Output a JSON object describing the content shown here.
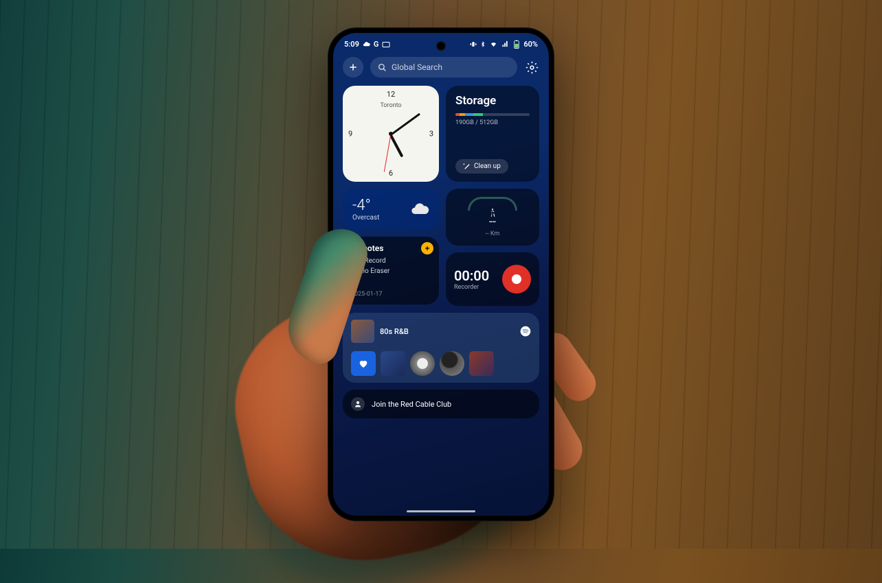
{
  "statusbar": {
    "time": "5:09",
    "indicators": "G",
    "battery": "60%"
  },
  "topbar": {
    "search_placeholder": "Global Search"
  },
  "clock": {
    "city": "Toronto",
    "n12": "12",
    "n3": "3",
    "n6": "6",
    "n9": "9"
  },
  "storage": {
    "title": "Storage",
    "usage": "190GB / 512GB",
    "cleanup_label": "Clean up"
  },
  "weather": {
    "temp": "-4°",
    "condition": "Overcast"
  },
  "notes": {
    "title": "All notes",
    "items": [
      "Call Record",
      "Audio Eraser",
      "…"
    ],
    "date": "2025-01-17"
  },
  "steps": {
    "value": "--",
    "unit": "-- Km"
  },
  "recorder": {
    "time": "00:00",
    "label": "Recorder"
  },
  "music": {
    "playlist": "80s R&B"
  },
  "promo": {
    "text": "Join the Red Cable Club"
  }
}
